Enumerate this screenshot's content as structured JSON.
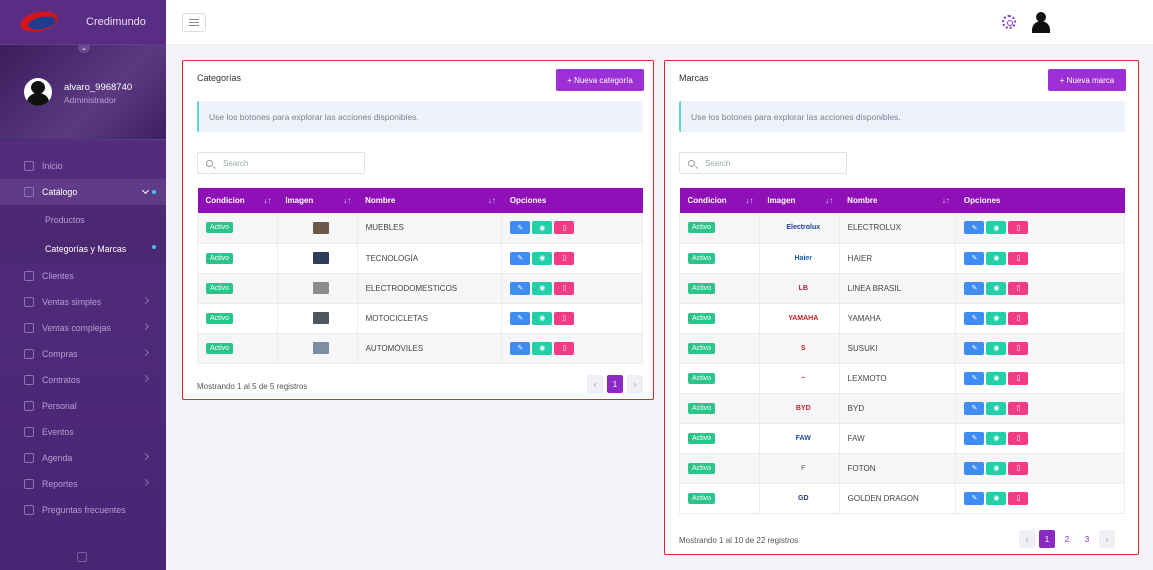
{
  "brand": {
    "name": "Credimundo"
  },
  "user": {
    "name": "alvaro_9968740",
    "role": "Administrador"
  },
  "nav": [
    {
      "label": "Inicio",
      "icon": "home-icon",
      "arrow": false
    },
    {
      "label": "Catálogo",
      "icon": "catalog-icon",
      "arrow": true,
      "active": true
    },
    {
      "label": "Clientes",
      "icon": "users-icon",
      "arrow": false
    },
    {
      "label": "Ventas simples",
      "icon": "cart-icon",
      "arrow": true
    },
    {
      "label": "Ventas complejas",
      "icon": "cart-icon",
      "arrow": true
    },
    {
      "label": "Compras",
      "icon": "bag-icon",
      "arrow": true
    },
    {
      "label": "Contratos",
      "icon": "contract-icon",
      "arrow": true
    },
    {
      "label": "Personal",
      "icon": "person-icon",
      "arrow": false
    },
    {
      "label": "Eventos",
      "icon": "calendar-icon",
      "arrow": false
    },
    {
      "label": "Agenda",
      "icon": "agenda-icon",
      "arrow": true
    },
    {
      "label": "Reportes",
      "icon": "report-icon",
      "arrow": true
    },
    {
      "label": "Preguntas frecuentes",
      "icon": "question-icon",
      "arrow": false
    }
  ],
  "subnav": [
    {
      "label": "Productos"
    },
    {
      "label": "Categorías y Marcas",
      "selected": true
    }
  ],
  "categories": {
    "title": "Categorías",
    "new_button": "+ Nueva categoría",
    "info": "Use los botones para explorar las acciones disponibles.",
    "search_placeholder": "Search",
    "headers": [
      "Condicion",
      "Imagen",
      "Nombre",
      "Opciones"
    ],
    "rows": [
      {
        "status": "Activo",
        "name": "MUEBLES",
        "thumb": "#6b5a4a"
      },
      {
        "status": "Activo",
        "name": "TECNOLOGÍA",
        "thumb": "#2d3c5a"
      },
      {
        "status": "Activo",
        "name": "ELECTRODOMESTICOS",
        "thumb": "#8a8c8e"
      },
      {
        "status": "Activo",
        "name": "MOTOCICLETAS",
        "thumb": "#4f5660"
      },
      {
        "status": "Activo",
        "name": "AUTOMÓVILES",
        "thumb": "#7d8ea4"
      }
    ],
    "footer": "Mostrando 1 al 5 de 5 registros",
    "pages": [
      "1"
    ]
  },
  "brands": {
    "title": "Marcas",
    "new_button": "+ Nueva marca",
    "info": "Use los botones para explorar las acciones disponibles.",
    "search_placeholder": "Search",
    "headers": [
      "Condicion",
      "Imagen",
      "Nombre",
      "Opciones"
    ],
    "rows": [
      {
        "status": "Activo",
        "name": "ELECTROLUX",
        "logo": "Electrolux",
        "color": "#1c3f94"
      },
      {
        "status": "Activo",
        "name": "HAIER",
        "logo": "Haier",
        "color": "#1c5fb0"
      },
      {
        "status": "Activo",
        "name": "LINEA BRASIL",
        "logo": "LB",
        "color": "#b3203a"
      },
      {
        "status": "Activo",
        "name": "YAMAHA",
        "logo": "YAMAHA",
        "color": "#c31d22"
      },
      {
        "status": "Activo",
        "name": "SUSUKI",
        "logo": "S",
        "color": "#d21c2c"
      },
      {
        "status": "Activo",
        "name": "LEXMOTO",
        "logo": "~",
        "color": "#d21c2c"
      },
      {
        "status": "Activo",
        "name": "BYD",
        "logo": "BYD",
        "color": "#c3202a"
      },
      {
        "status": "Activo",
        "name": "FAW",
        "logo": "FAW",
        "color": "#2250a0"
      },
      {
        "status": "Activo",
        "name": "FOTON",
        "logo": "F",
        "color": "#888888"
      },
      {
        "status": "Activo",
        "name": "GOLDEN DRAGON",
        "logo": "GD",
        "color": "#2a3a88"
      }
    ],
    "footer": "Mostrando 1 al 10 de 22 registros",
    "pages": [
      "1",
      "2",
      "3"
    ]
  }
}
